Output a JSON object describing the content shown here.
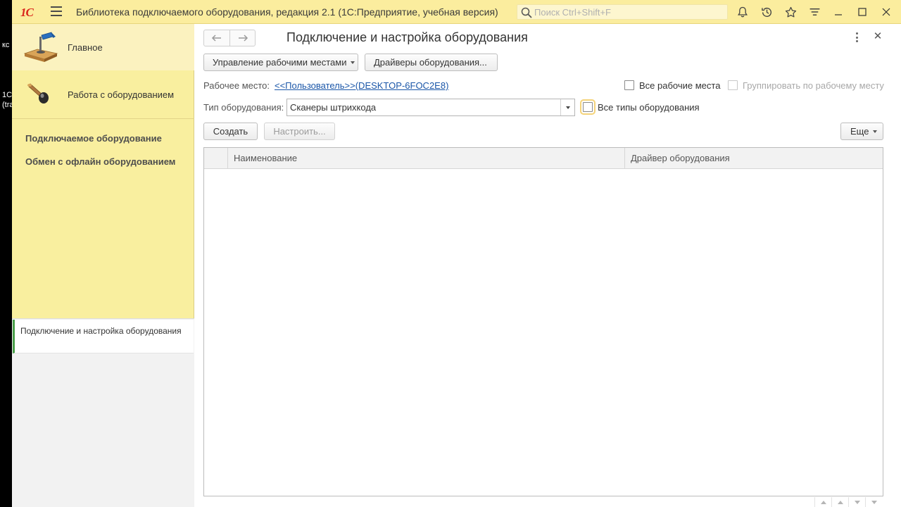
{
  "window": {
    "logo_text": "1С",
    "app_title": "Библиотека подключаемого оборудования, редакция 2.1  (1С:Предприятие, учебная версия)",
    "search_placeholder": "Поиск Ctrl+Shift+F"
  },
  "desktop": {
    "fragments": [
      "кс",
      "1С",
      "(tra"
    ]
  },
  "sections": [
    {
      "label": "Главное",
      "icon": "desk-lamp-icon",
      "active": true
    },
    {
      "label": "Работа с оборудованием",
      "icon": "equipment-icon",
      "active": false
    }
  ],
  "nav_links": [
    "Подключаемое оборудование",
    "Обмен с офлайн оборудованием"
  ],
  "open_windows": [
    "Подключение и настройка оборудования"
  ],
  "form": {
    "title": "Подключение и настройка оборудования",
    "btn_workplaces": "Управление рабочими местами",
    "btn_drivers": "Драйверы оборудования...",
    "workplace_label": "Рабочее место:",
    "workplace_value": "<<Пользователь>>(DESKTOP-6FOC2E8)",
    "chk_all_workplaces": "Все рабочие места",
    "chk_group_by_workplace": "Группировать по рабочему месту",
    "type_label": "Тип оборудования:",
    "type_value": "Сканеры штрихкода",
    "chk_all_types": "Все типы оборудования",
    "btn_create": "Создать",
    "btn_configure": "Настроить...",
    "btn_more": "Еще"
  },
  "table": {
    "columns": [
      "Наименование",
      "Драйвер оборудования"
    ],
    "rows": []
  },
  "colors": {
    "titlebar": "#fbed9e",
    "panel": "#f9ef9f",
    "link": "#1a56a8",
    "accent_green": "#4aa04a"
  }
}
